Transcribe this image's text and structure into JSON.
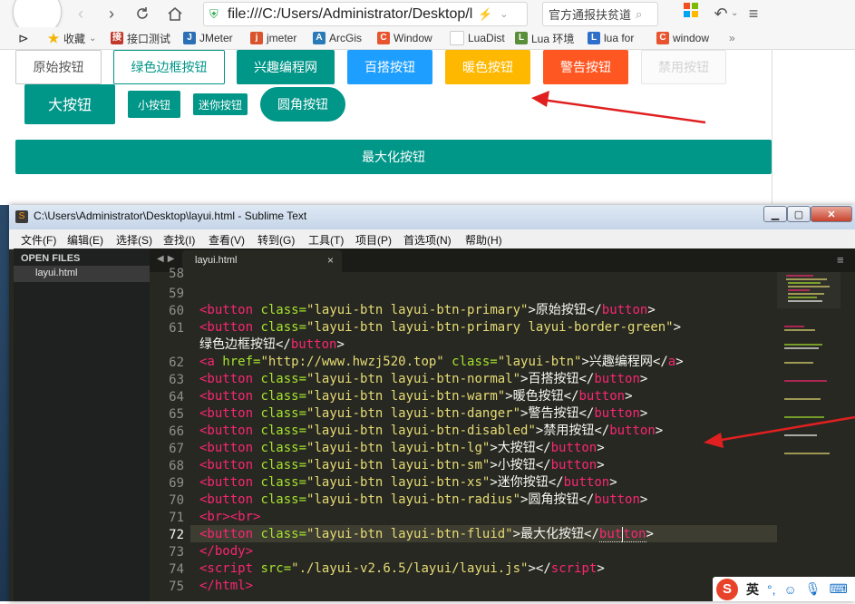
{
  "browser": {
    "url": "file:///C:/Users/Administrator/Desktop/la",
    "search_text": "官方通报扶贫道",
    "bookmarks": [
      {
        "label": "收藏",
        "icon": "star-icon",
        "color": "#f4b400"
      },
      {
        "label": "接口测试",
        "icon": "bookmark-favicon",
        "color": "#c0392b"
      },
      {
        "label": "JMeter",
        "icon": "bookmark-favicon",
        "color": "#2c6fb5"
      },
      {
        "label": "jmeter",
        "icon": "bookmark-favicon",
        "color": "#d9532c"
      },
      {
        "label": "ArcGis",
        "icon": "bookmark-favicon",
        "color": "#2a7ab8"
      },
      {
        "label": "Window",
        "icon": "bookmark-favicon",
        "color": "#e8542f"
      },
      {
        "label": "LuaDist",
        "icon": "bookmark-favicon",
        "color": "#dddddd"
      },
      {
        "label": "Lua 环境",
        "icon": "bookmark-favicon",
        "color": "#5a8f3a"
      },
      {
        "label": "lua for",
        "icon": "bookmark-favicon",
        "color": "#2f6fc9"
      },
      {
        "label": "window",
        "icon": "bookmark-favicon",
        "color": "#e8542f"
      }
    ]
  },
  "preview": {
    "buttons": {
      "primary": "原始按钮",
      "green_border": "绿色边框按钮",
      "link": "兴趣编程网",
      "normal": "百搭按钮",
      "warm": "暖色按钮",
      "danger": "警告按钮",
      "disabled": "禁用按钮",
      "large": "大按钮",
      "small": "小按钮",
      "mini": "迷你按钮",
      "radius": "圆角按钮",
      "fluid": "最大化按钮"
    }
  },
  "sublime": {
    "title": "C:\\Users\\Administrator\\Desktop\\layui.html - Sublime Text",
    "menu": [
      "文件(F)",
      "编辑(E)",
      "选择(S)",
      "查找(I)",
      "查看(V)",
      "转到(G)",
      "工具(T)",
      "项目(P)",
      "首选项(N)",
      "帮助(H)"
    ],
    "sidebar_heading": "OPEN FILES",
    "open_file": "layui.html",
    "tab_label": "layui.html",
    "line_numbers": [
      "58",
      "59",
      "60",
      "61",
      "",
      "62",
      "63",
      "64",
      "65",
      "66",
      "67",
      "68",
      "69",
      "70",
      "71",
      "72",
      "73",
      "74",
      "75"
    ],
    "current_line": "72",
    "code": {
      "l60": {
        "t1": "<button",
        "a1": " class=",
        "s1": "\"layui-btn layui-btn-primary\"",
        "x": ">原始按钮</",
        "t2": "button",
        "e": ">"
      },
      "l61": {
        "t1": "<button",
        "a1": " class=",
        "s1": "\"layui-btn layui-btn-primary layui-border-green\"",
        "e": ">"
      },
      "l61b": {
        "x": "绿色边框按钮</",
        "t2": "button",
        "e": ">"
      },
      "l62": {
        "t1": "<a",
        "a1": " href=",
        "s1": "\"http://www.hwzj520.top\"",
        "a2": " class=",
        "s2": "\"layui-btn\"",
        "x": ">兴趣编程网</",
        "t2": "a",
        "e": ">"
      },
      "l63": {
        "t1": "<button",
        "a1": " class=",
        "s1": "\"layui-btn layui-btn-normal\"",
        "x": ">百搭按钮</",
        "t2": "button",
        "e": ">"
      },
      "l64": {
        "t1": "<button",
        "a1": " class=",
        "s1": "\"layui-btn layui-btn-warm\"",
        "x": ">暖色按钮</",
        "t2": "button",
        "e": ">"
      },
      "l65": {
        "t1": "<button",
        "a1": " class=",
        "s1": "\"layui-btn layui-btn-danger\"",
        "x": ">警告按钮</",
        "t2": "button",
        "e": ">"
      },
      "l66": {
        "t1": "<button",
        "a1": " class=",
        "s1": "\"layui-btn layui-btn-disabled\"",
        "x": ">禁用按钮</",
        "t2": "button",
        "e": ">"
      },
      "l67": {
        "t1": "<button",
        "a1": " class=",
        "s1": "\"layui-btn layui-btn-lg\"",
        "x": ">大按钮</",
        "t2": "button",
        "e": ">"
      },
      "l68": {
        "t1": "<button",
        "a1": " class=",
        "s1": "\"layui-btn layui-btn-sm\"",
        "x": ">小按钮</",
        "t2": "button",
        "e": ">"
      },
      "l69": {
        "t1": "<button",
        "a1": " class=",
        "s1": "\"layui-btn layui-btn-xs\"",
        "x": ">迷你按钮</",
        "t2": "button",
        "e": ">"
      },
      "l70": {
        "t1": "<button",
        "a1": " class=",
        "s1": "\"layui-btn layui-btn-radius\"",
        "x": ">圆角按钮</",
        "t2": "button",
        "e": ">"
      },
      "l71": {
        "a": "<br><br>"
      },
      "l72": {
        "t1": "<button",
        "a1": " class=",
        "s1": "\"layui-btn layui-btn-fluid\"",
        "x": ">最大化按钮</",
        "t2a": "but",
        "t2b": "ton",
        "e": ">"
      },
      "l73": {
        "a": "</body>"
      },
      "l74": {
        "t1": "<script",
        "a1": " src=",
        "s1": "\"./layui-v2.6.5/layui/layui.js\"",
        "x": "></",
        "t2": "script",
        "e": ">"
      },
      "l75": {
        "a": "</html>"
      }
    }
  },
  "ime": {
    "logo": "S",
    "lang": "英"
  },
  "colors": {
    "teal": "#009688",
    "blue": "#1e9fff",
    "warm": "#ffb800",
    "danger": "#ff5722",
    "arrow": "#e02020",
    "editor_bg": "#272822"
  }
}
